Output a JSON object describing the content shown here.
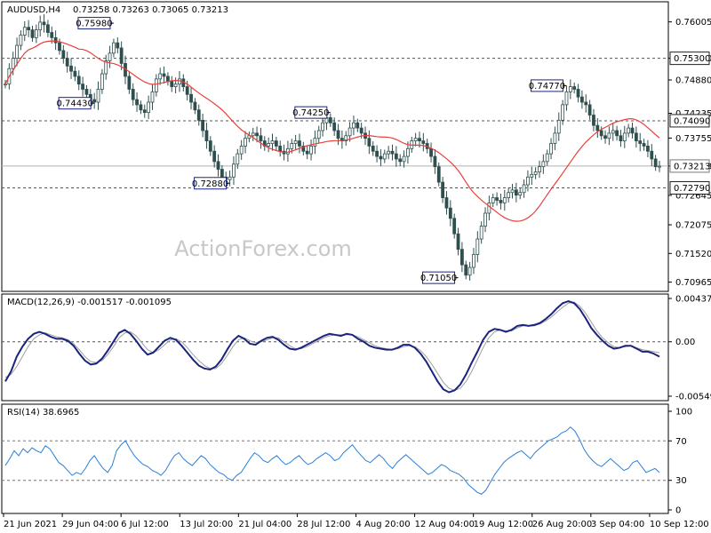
{
  "chart_data": [
    {
      "type": "candlestick",
      "panel": "price",
      "symbol_label": "AUDUSD,H4",
      "ohlc_label": "0.73258 0.73263 0.73065 0.73213",
      "ylim": [
        0.7082,
        0.7636
      ],
      "y_ticks": [
        "0.76005",
        "0.75300",
        "0.74880",
        "0.74235",
        "0.73755",
        "0.73213",
        "0.72645",
        "0.72075",
        "0.71520",
        "0.70965"
      ],
      "right_badges": [
        {
          "value": 0.753,
          "label": "0.75300",
          "style": "dark-box"
        },
        {
          "value": 0.7409,
          "label": "0.74090",
          "style": "dark-box"
        },
        {
          "value": 0.73213,
          "label": "0.73213",
          "style": "current"
        },
        {
          "value": 0.7279,
          "label": "0.72790",
          "style": "dark-box"
        }
      ],
      "levels": [
        {
          "value": 0.753,
          "style": "dashed"
        },
        {
          "value": 0.7409,
          "style": "dashed"
        },
        {
          "value": 0.73213,
          "style": "solid-gray"
        },
        {
          "value": 0.7279,
          "style": "dashed"
        }
      ],
      "annotations": [
        {
          "label": "0.75980",
          "x_index": 28,
          "value": 0.7598
        },
        {
          "label": "0.74430",
          "x_index": 23,
          "value": 0.7443
        },
        {
          "label": "0.72880",
          "x_index": 58,
          "value": 0.7288
        },
        {
          "label": "0.74250",
          "x_index": 84,
          "value": 0.7425
        },
        {
          "label": "0.71050",
          "x_index": 117,
          "value": 0.7105
        },
        {
          "label": "0.74770",
          "x_index": 145,
          "value": 0.7477
        }
      ],
      "series_close": [
        0.748,
        0.751,
        0.753,
        0.7555,
        0.7575,
        0.759,
        0.7585,
        0.757,
        0.7585,
        0.76,
        0.7595,
        0.758,
        0.757,
        0.756,
        0.7545,
        0.753,
        0.7515,
        0.7505,
        0.7495,
        0.748,
        0.747,
        0.746,
        0.745,
        0.7445,
        0.747,
        0.75,
        0.7525,
        0.754,
        0.756,
        0.755,
        0.752,
        0.7495,
        0.747,
        0.745,
        0.744,
        0.743,
        0.7425,
        0.7445,
        0.7465,
        0.749,
        0.75,
        0.7495,
        0.7485,
        0.7475,
        0.748,
        0.749,
        0.7475,
        0.746,
        0.7445,
        0.743,
        0.741,
        0.739,
        0.737,
        0.735,
        0.733,
        0.7315,
        0.73,
        0.7295,
        0.73,
        0.7325,
        0.7345,
        0.736,
        0.7375,
        0.738,
        0.7385,
        0.738,
        0.737,
        0.736,
        0.7365,
        0.737,
        0.736,
        0.735,
        0.7345,
        0.7355,
        0.7365,
        0.737,
        0.736,
        0.735,
        0.7345,
        0.736,
        0.7375,
        0.739,
        0.7405,
        0.7415,
        0.7405,
        0.739,
        0.7375,
        0.737,
        0.738,
        0.7395,
        0.7405,
        0.7395,
        0.7385,
        0.7375,
        0.736,
        0.735,
        0.734,
        0.7335,
        0.7345,
        0.735,
        0.7345,
        0.7335,
        0.733,
        0.734,
        0.7355,
        0.737,
        0.7375,
        0.737,
        0.7365,
        0.7355,
        0.734,
        0.732,
        0.729,
        0.726,
        0.724,
        0.722,
        0.719,
        0.716,
        0.713,
        0.711,
        0.7125,
        0.715,
        0.718,
        0.7205,
        0.723,
        0.725,
        0.726,
        0.7255,
        0.725,
        0.726,
        0.727,
        0.7275,
        0.7265,
        0.727,
        0.7285,
        0.73,
        0.7305,
        0.731,
        0.732,
        0.733,
        0.7345,
        0.7365,
        0.7385,
        0.741,
        0.744,
        0.7465,
        0.7475,
        0.747,
        0.7455,
        0.7445,
        0.744,
        0.742,
        0.74,
        0.739,
        0.738,
        0.7375,
        0.7385,
        0.739,
        0.738,
        0.737,
        0.7385,
        0.7395,
        0.7385,
        0.737,
        0.7365,
        0.736,
        0.735,
        0.7335,
        0.732,
        0.7321
      ],
      "ma": {
        "period": 20,
        "color": "#e8403a"
      },
      "watermark": "ActionForex.com"
    },
    {
      "type": "line",
      "panel": "macd",
      "label": "MACD(12,26,9) -0.001517 -0.001095",
      "ylim": [
        -0.005495,
        0.004371
      ],
      "y_ticks": [
        "0.004371",
        "0.00",
        "-0.005495"
      ],
      "series": [
        {
          "values": [
            -0.004,
            -0.003,
            -0.0015,
            -0.0005,
            0.0003,
            0.0008,
            0.001,
            0.0008,
            0.0005,
            0.0003,
            0.0003,
            0.0001,
            -0.0004,
            -0.0012,
            -0.0019,
            -0.0023,
            -0.0022,
            -0.0017,
            -0.0009,
            0.0,
            0.0009,
            0.0012,
            0.0008,
            0.0001,
            -0.0007,
            -0.0013,
            -0.0011,
            -0.0005,
            0.0001,
            0.0004,
            0.0002,
            -0.0004,
            -0.0011,
            -0.0018,
            -0.0024,
            -0.0027,
            -0.0028,
            -0.0025,
            -0.0018,
            -0.0008,
            0.0001,
            0.0006,
            0.0003,
            -0.0002,
            -0.0003,
            0.0001,
            0.0004,
            0.0005,
            0.0002,
            -0.0003,
            -0.0007,
            -0.0008,
            -0.0006,
            -0.0003,
            0.0,
            0.0003,
            0.0006,
            0.0008,
            0.0007,
            0.0006,
            0.0008,
            0.0007,
            0.0003,
            0.0,
            -0.0004,
            -0.0006,
            -0.0007,
            -0.0008,
            -0.0008,
            -0.0006,
            -0.0003,
            -0.0003,
            -0.0006,
            -0.0012,
            -0.002,
            -0.003,
            -0.004,
            -0.0048,
            -0.0051,
            -0.0049,
            -0.0043,
            -0.0033,
            -0.0021,
            -0.001,
            0.0002,
            0.001,
            0.0013,
            0.0012,
            0.001,
            0.0012,
            0.0016,
            0.0017,
            0.0016,
            0.0017,
            0.0019,
            0.0023,
            0.0028,
            0.0034,
            0.0039,
            0.0041,
            0.0039,
            0.0033,
            0.0024,
            0.0014,
            0.0007,
            0.0001,
            -0.0004,
            -0.0007,
            -0.0006,
            -0.0004,
            -0.0004,
            -0.0007,
            -0.001,
            -0.001,
            -0.0012,
            -0.0015
          ]
        },
        {
          "values": [
            -0.0036,
            -0.0033,
            -0.0025,
            -0.0015,
            -0.0005,
            0.0003,
            0.0007,
            0.0009,
            0.0007,
            0.0005,
            0.0004,
            0.0002,
            -0.0002,
            -0.0008,
            -0.0015,
            -0.002,
            -0.0021,
            -0.0019,
            -0.0013,
            -0.0005,
            0.0004,
            0.0009,
            0.001,
            0.0006,
            -0.0001,
            -0.0008,
            -0.0011,
            -0.0008,
            -0.0003,
            0.0002,
            0.0003,
            0.0,
            -0.0006,
            -0.0013,
            -0.0019,
            -0.0024,
            -0.0027,
            -0.0027,
            -0.0022,
            -0.0014,
            -0.0005,
            0.0002,
            0.0004,
            0.0001,
            -0.0001,
            0.0,
            0.0002,
            0.0004,
            0.0004,
            0.0,
            -0.0004,
            -0.0007,
            -0.0007,
            -0.0005,
            -0.0002,
            0.0001,
            0.0004,
            0.0006,
            0.0007,
            0.0007,
            0.0007,
            0.0007,
            0.0005,
            0.0002,
            -0.0001,
            -0.0004,
            -0.0006,
            -0.0007,
            -0.0008,
            -0.0007,
            -0.0005,
            -0.0004,
            -0.0005,
            -0.0009,
            -0.0015,
            -0.0023,
            -0.0032,
            -0.0041,
            -0.0047,
            -0.0049,
            -0.0047,
            -0.004,
            -0.003,
            -0.0018,
            -0.0006,
            0.0004,
            0.001,
            0.0012,
            0.0011,
            0.0011,
            0.0014,
            0.0016,
            0.0016,
            0.0016,
            0.0018,
            0.0021,
            0.0025,
            0.003,
            0.0035,
            0.0039,
            0.004,
            0.0036,
            0.0029,
            0.002,
            0.0011,
            0.0004,
            -0.0001,
            -0.0005,
            -0.0006,
            -0.0005,
            -0.0004,
            -0.0006,
            -0.0008,
            -0.0009,
            -0.001,
            -0.0011
          ]
        }
      ]
    },
    {
      "type": "line",
      "panel": "rsi",
      "label": "RSI(14) 38.6965",
      "ylim": [
        0,
        100
      ],
      "y_ticks": [
        100,
        70,
        30,
        0
      ],
      "levels": [
        70,
        30
      ],
      "series": [
        {
          "values": [
            45,
            52,
            60,
            55,
            62,
            58,
            63,
            60,
            58,
            65,
            62,
            55,
            48,
            45,
            40,
            35,
            38,
            36,
            42,
            50,
            55,
            48,
            42,
            38,
            45,
            60,
            66,
            70,
            62,
            55,
            50,
            46,
            44,
            40,
            38,
            35,
            40,
            48,
            55,
            58,
            52,
            48,
            45,
            50,
            55,
            52,
            46,
            42,
            38,
            36,
            32,
            30,
            35,
            38,
            45,
            52,
            58,
            55,
            50,
            48,
            52,
            55,
            50,
            46,
            48,
            52,
            55,
            50,
            46,
            48,
            52,
            55,
            58,
            55,
            50,
            52,
            58,
            62,
            66,
            60,
            55,
            50,
            48,
            52,
            56,
            52,
            46,
            42,
            48,
            52,
            56,
            52,
            48,
            44,
            40,
            36,
            38,
            42,
            46,
            44,
            40,
            38,
            36,
            32,
            26,
            22,
            18,
            16,
            20,
            28,
            36,
            42,
            48,
            52,
            55,
            58,
            60,
            56,
            52,
            58,
            62,
            66,
            70,
            72,
            74,
            78,
            80,
            84,
            80,
            72,
            62,
            55,
            50,
            46,
            44,
            48,
            52,
            48,
            44,
            40,
            42,
            48,
            50,
            44,
            38,
            40,
            42,
            38
          ]
        }
      ]
    }
  ],
  "x_axis": {
    "tick_labels": [
      "21 Jun 2021",
      "29 Jun 04:00",
      "6 Jul 12:00",
      "13 Jul 20:00",
      "21 Jul 04:00",
      "28 Jul 12:00",
      "4 Aug 20:00",
      "12 Aug 04:00",
      "19 Aug 12:00",
      "26 Aug 20:00",
      "3 Sep 04:00",
      "10 Sep 12:00"
    ]
  },
  "colors": {
    "candle": "#2f4f4f",
    "ma": "#e8403a",
    "macd": "#1a237e",
    "signal": "#9e9e9e",
    "rsi": "#2a7fd8",
    "grid_dash": "#555555",
    "badge_bg": "#222222",
    "watermark": "#c8c8c8"
  }
}
